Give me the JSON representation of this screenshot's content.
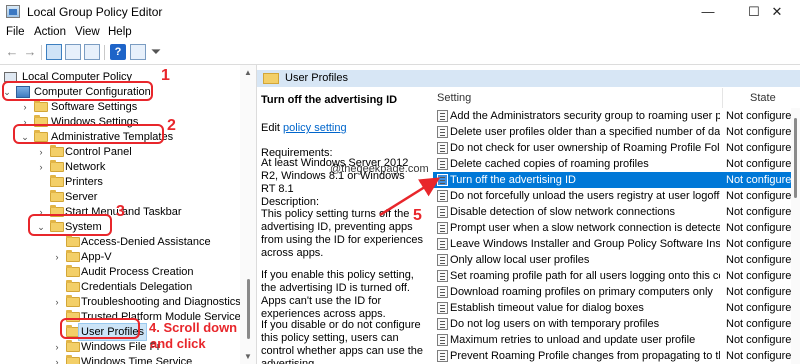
{
  "window": {
    "title": "Local Group Policy Editor",
    "minimize_glyph": "—",
    "maximize_glyph": "☐",
    "close_glyph": "✕"
  },
  "menu": [
    "File",
    "Action",
    "View",
    "Help"
  ],
  "toolbar": {
    "back_glyph": "←",
    "forward_glyph": "→",
    "help_glyph": "?",
    "filter_glyph": "⏷"
  },
  "tree": {
    "root": "Local Computer Policy",
    "computer_configuration": "Computer Configuration",
    "software_settings": "Software Settings",
    "windows_settings": "Windows Settings",
    "administrative_templates": "Administrative Templates",
    "control_panel": "Control Panel",
    "network": "Network",
    "printers": "Printers",
    "server": "Server",
    "start_menu_taskbar": "Start Menu and Taskbar",
    "system": "System",
    "access_denied_assistance": "Access-Denied Assistance",
    "app_v": "App-V",
    "audit_process_creation": "Audit Process Creation",
    "credentials_delegation": "Credentials Delegation",
    "troubleshooting": "Troubleshooting and Diagnostics",
    "trusted_platform": "Trusted Platform Module Services",
    "user_profiles": "User Profiles",
    "windows_file_protection": "Windows File Pr",
    "windows_time_service": "Windows Time Service",
    "chev_expanded": "⌄",
    "chev_collapsed": "›",
    "scroll_up": "▲",
    "scroll_down": "▼"
  },
  "annotations": {
    "step1": "1",
    "step2": "2",
    "step3": "3",
    "step4": "4. Scroll down",
    "step4_line2": "and click",
    "step5": "5",
    "color": "#e8262b"
  },
  "header": {
    "title": "User Profiles"
  },
  "description": {
    "title": "Turn off the advertising ID",
    "edit_prefix": "Edit ",
    "edit_link": "policy setting",
    "requirements_label": "Requirements:",
    "requirements_text": "At least Windows Server 2012 R2, Windows 8.1 or Windows RT 8.1",
    "description_label": "Description:",
    "description_text": "This policy setting turns off the advertising ID, preventing apps from using the ID for experiences across apps.",
    "enabled_text": "If you enable this policy setting, the advertising ID is turned off. Apps can't use the ID for experiences across apps.",
    "disabled_text": "If you disable or do not configure this policy setting, users can control whether apps can use the advertising",
    "watermark": "@thegeekpage.com"
  },
  "settings": {
    "col_setting": "Setting",
    "col_state": "State",
    "rows": [
      {
        "name": "Add the Administrators security group to roaming user profi...",
        "state": "Not configure"
      },
      {
        "name": "Delete user profiles older than a specified number of days o...",
        "state": "Not configure"
      },
      {
        "name": "Do not check for user ownership of Roaming Profile Folders",
        "state": "Not configure"
      },
      {
        "name": "Delete cached copies of roaming profiles",
        "state": "Not configure"
      },
      {
        "name": "Turn off the advertising ID",
        "state": "Not configure"
      },
      {
        "name": "Do not forcefully unload the users registry at user logoff",
        "state": "Not configure"
      },
      {
        "name": "Disable detection of slow network connections",
        "state": "Not configure"
      },
      {
        "name": "Prompt user when a slow network connection is detected",
        "state": "Not configure"
      },
      {
        "name": "Leave Windows Installer and Group Policy Software Installati...",
        "state": "Not configure"
      },
      {
        "name": "Only allow local user profiles",
        "state": "Not configure"
      },
      {
        "name": "Set roaming profile path for all users logging onto this com...",
        "state": "Not configure"
      },
      {
        "name": "Download roaming profiles on primary computers only",
        "state": "Not configure"
      },
      {
        "name": "Establish timeout value for dialog boxes",
        "state": "Not configure"
      },
      {
        "name": "Do not log users on with temporary profiles",
        "state": "Not configure"
      },
      {
        "name": "Maximum retries to unload and update user profile",
        "state": "Not configure"
      },
      {
        "name": "Prevent Roaming Profile changes from propagating to the se...",
        "state": "Not configure"
      }
    ]
  }
}
